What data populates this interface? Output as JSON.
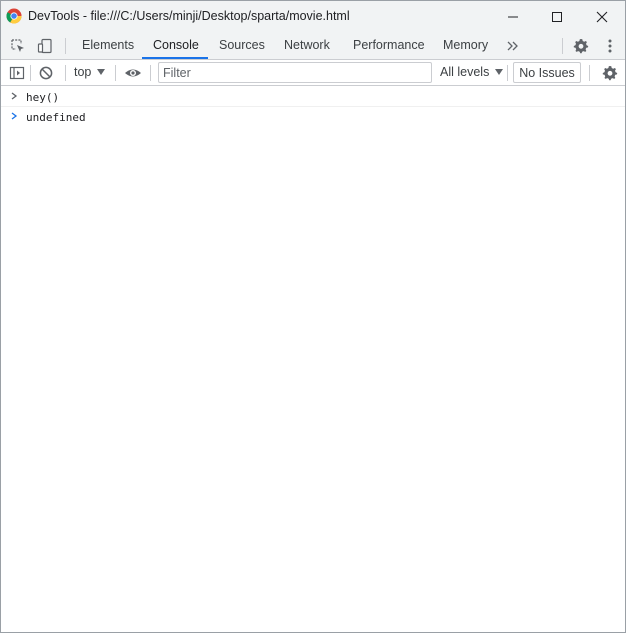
{
  "window": {
    "title": "DevTools - file:///C:/Users/minji/Desktop/sparta/movie.html"
  },
  "tabs": [
    {
      "label": "Elements",
      "active": false
    },
    {
      "label": "Console",
      "active": true
    },
    {
      "label": "Sources",
      "active": false
    },
    {
      "label": "Network",
      "active": false
    },
    {
      "label": "Performance",
      "active": false
    },
    {
      "label": "Memory",
      "active": false
    }
  ],
  "toolbar": {
    "context": "top",
    "filter_placeholder": "Filter",
    "levels": "All levels",
    "issues": "No Issues"
  },
  "console": {
    "input": "hey()",
    "result": "undefined"
  },
  "colors": {
    "accent": "#1a73e8",
    "chrome_bg": "#f1f3f4",
    "icon": "#5f6368",
    "result_chevron": "#1a73e8"
  }
}
